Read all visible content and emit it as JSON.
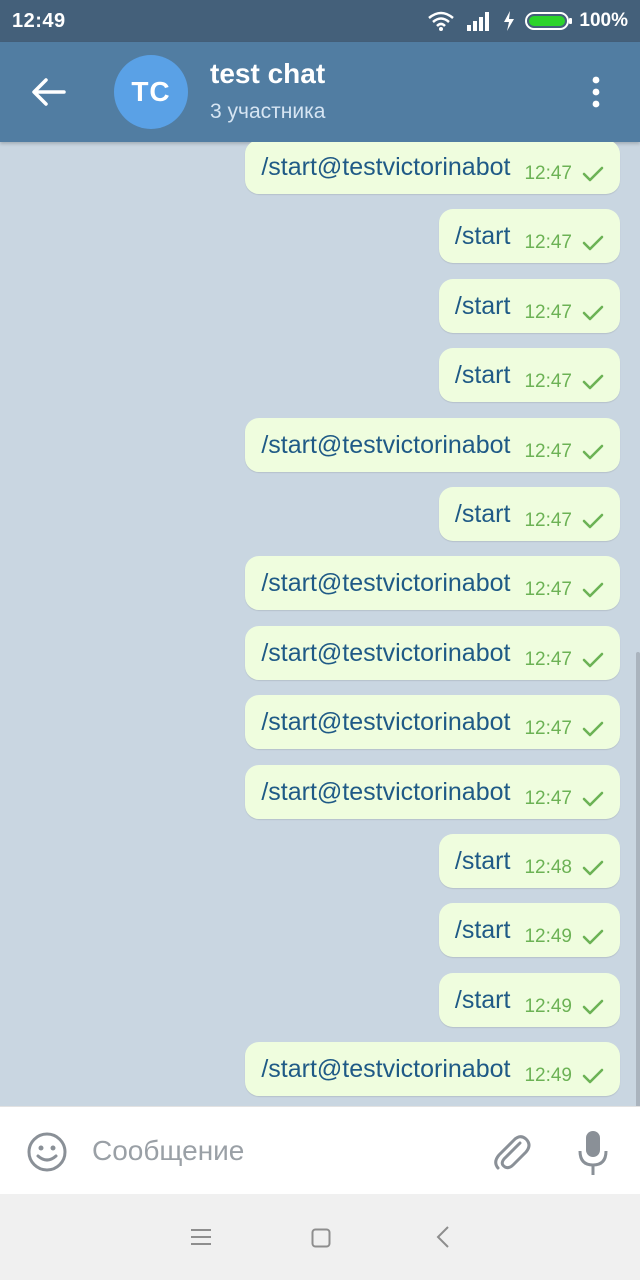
{
  "status_bar": {
    "time": "12:49",
    "battery_percent": "100%",
    "battery_level": 1.0
  },
  "header": {
    "avatar_initials": "TC",
    "title": "test chat",
    "subtitle": "3 участника"
  },
  "messages": [
    {
      "text": "/start@testvictorinabot",
      "time": "12:47"
    },
    {
      "text": "/start",
      "time": "12:47"
    },
    {
      "text": "/start",
      "time": "12:47"
    },
    {
      "text": "/start",
      "time": "12:47"
    },
    {
      "text": "/start@testvictorinabot",
      "time": "12:47"
    },
    {
      "text": "/start",
      "time": "12:47"
    },
    {
      "text": "/start@testvictorinabot",
      "time": "12:47"
    },
    {
      "text": "/start@testvictorinabot",
      "time": "12:47"
    },
    {
      "text": "/start@testvictorinabot",
      "time": "12:47"
    },
    {
      "text": "/start@testvictorinabot",
      "time": "12:47"
    },
    {
      "text": "/start",
      "time": "12:48"
    },
    {
      "text": "/start",
      "time": "12:49"
    },
    {
      "text": "/start",
      "time": "12:49"
    },
    {
      "text": "/start@testvictorinabot",
      "time": "12:49"
    }
  ],
  "input": {
    "placeholder": "Сообщение"
  },
  "colors": {
    "header": "#517da2",
    "status_bar": "#44607a",
    "bubble": "#effdde",
    "message_text": "#1f5a86",
    "time_text": "#6cb255",
    "background": "#c9d6e1"
  },
  "icons": [
    "wifi-icon",
    "signal-icon",
    "charging-icon",
    "battery-icon",
    "back-arrow-icon",
    "more-menu-icon",
    "check-icon",
    "emoji-icon",
    "attach-icon",
    "mic-icon",
    "nav-menu-icon",
    "nav-home-icon",
    "nav-back-icon"
  ]
}
